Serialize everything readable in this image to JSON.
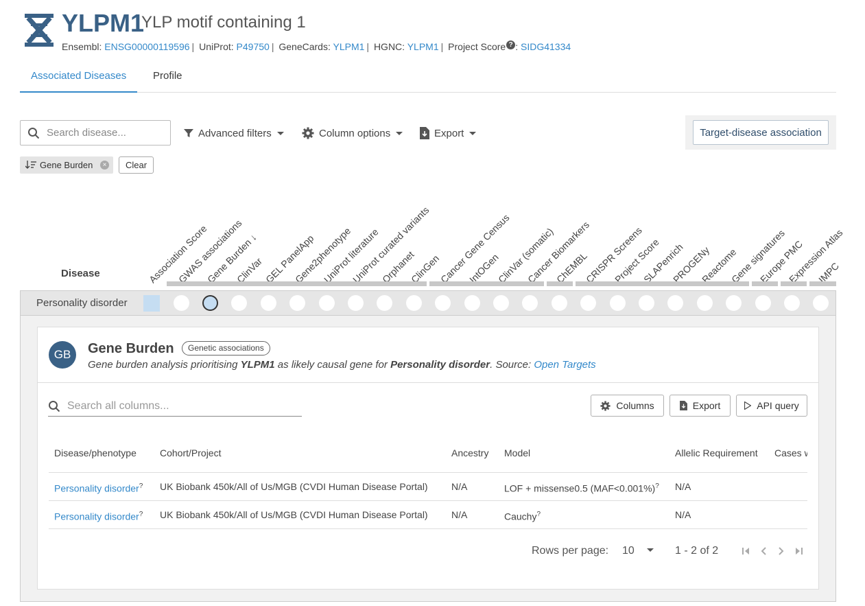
{
  "gene": {
    "symbol": "YLPM1",
    "name": "YLP motif containing 1",
    "xrefs": [
      {
        "label": "Ensembl:",
        "value": "ENSG00000119596"
      },
      {
        "label": "UniProt:",
        "value": "P49750"
      },
      {
        "label": "GeneCards:",
        "value": "YLPM1"
      },
      {
        "label": "HGNC:",
        "value": "YLPM1"
      },
      {
        "label": "Project Score",
        "value": "SIDG41334"
      }
    ],
    "help_icon": "?"
  },
  "tabs": [
    {
      "label": "Associated Diseases",
      "active": true
    },
    {
      "label": "Profile",
      "active": false
    }
  ],
  "toolbar": {
    "search_placeholder": "Search disease...",
    "advanced_filters": "Advanced filters",
    "column_options": "Column options",
    "export": "Export",
    "target_disease": "Target-disease association"
  },
  "active_filters": {
    "chip_label": "Gene Burden",
    "clear_label": "Clear"
  },
  "association_table": {
    "disease_header": "Disease",
    "columns": [
      "Association Score",
      "GWAS associations",
      "Gene Burden ↓",
      "ClinVar",
      "GEL PanelApp",
      "Gene2phenotype",
      "UniProt literature",
      "UniProt curated variants",
      "Orphanet",
      "ClinGen",
      "Cancer Gene Census",
      "IntOGen",
      "ClinVar (somatic)",
      "Cancer Biomarkers",
      "ChEMBL",
      "CRISPR Screens",
      "Project Score",
      "SLAPenrich",
      "PROGENy",
      "Reactome",
      "Gene signatures",
      "Europe PMC",
      "Expression Atlas",
      "IMPC"
    ],
    "row": {
      "disease": "Personality disorder",
      "association_score": 0.2,
      "selected_column": "Gene Burden"
    }
  },
  "detail": {
    "avatar": "GB",
    "title": "Gene Burden",
    "badge": "Genetic associations",
    "desc_1": "Gene burden analysis prioritising ",
    "desc_gene": "YLPM1",
    "desc_2": " as likely causal gene for ",
    "desc_disease": "Personality disorder",
    "desc_3": ". Source: ",
    "desc_source": "Open Targets",
    "search_placeholder": "Search all columns...",
    "columns_btn": "Columns",
    "export_btn": "Export",
    "api_btn": "API query",
    "headers": [
      "Disease/phenotype",
      "Cohort/Project",
      "Ancestry",
      "Model",
      "Allelic Requirement",
      "Cases with"
    ],
    "rows": [
      {
        "disease": "Personality disorder",
        "cohort": "UK Biobank 450k/All of Us/MGB (CVDI Human Disease Portal)",
        "ancestry": "N/A",
        "model": "LOF + missense0.5 (MAF<0.001%)",
        "allelic": "N/A"
      },
      {
        "disease": "Personality disorder",
        "cohort": "UK Biobank 450k/All of Us/MGB (CVDI Human Disease Portal)",
        "ancestry": "N/A",
        "model": "Cauchy",
        "allelic": "N/A"
      }
    ],
    "sup": "?",
    "rows_per_page_label": "Rows per page:",
    "rows_per_page": "10",
    "range": "1 - 2 of 2"
  },
  "colors": {
    "brand": "#3a6186",
    "link": "#3489ca",
    "score_fill": "#c5ddf2",
    "row_bg": "#e6e6e6"
  },
  "icons": [
    "dna-logo-icon",
    "search-icon",
    "filter-icon",
    "gear-icon",
    "export-file-icon",
    "sort-icon",
    "close-icon",
    "play-icon",
    "first-page-icon",
    "prev-page-icon",
    "next-page-icon",
    "last-page-icon",
    "dropdown-icon",
    "help-icon"
  ]
}
